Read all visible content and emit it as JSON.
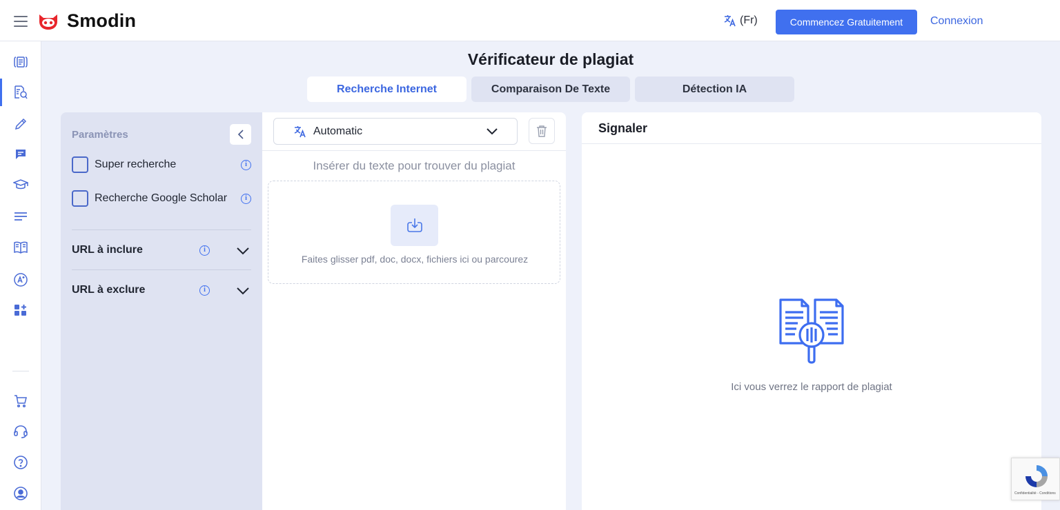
{
  "header": {
    "brand": "Smodin",
    "language_label": "(Fr)",
    "cta_label": "Commencez Gratuitement",
    "login_label": "Connexion"
  },
  "sidebar": {
    "items": [
      {
        "icon": "document-brackets-icon"
      },
      {
        "icon": "plagiarism-search-icon",
        "active": true
      },
      {
        "icon": "pencil-icon"
      },
      {
        "icon": "chat-icon"
      },
      {
        "icon": "graduation-cap-icon"
      },
      {
        "icon": "text-lines-icon"
      },
      {
        "icon": "book-icon"
      },
      {
        "icon": "ai-badge-icon"
      },
      {
        "icon": "apps-add-icon"
      },
      {
        "icon": "cart-icon"
      },
      {
        "icon": "headset-icon"
      },
      {
        "icon": "help-icon"
      },
      {
        "icon": "user-icon"
      }
    ]
  },
  "page": {
    "title": "Vérificateur de plagiat",
    "tabs": [
      {
        "label": "Recherche Internet",
        "active": true
      },
      {
        "label": "Comparaison De Texte",
        "active": false
      },
      {
        "label": "Détection IA",
        "active": false
      }
    ]
  },
  "settings": {
    "title": "Paramètres",
    "options": [
      {
        "label": "Super recherche",
        "checked": false
      },
      {
        "label": "Recherche Google Scholar",
        "checked": false
      }
    ],
    "url_include": "URL à inclure",
    "url_exclude": "URL à exclure"
  },
  "editor": {
    "language_value": "Automatic",
    "placeholder": "Insérer du texte pour trouver du plagiat",
    "dropzone_text": "Faites glisser pdf, doc, docx, fichiers ici ou parcourez"
  },
  "report": {
    "title": "Signaler",
    "empty_text": "Ici vous verrez le rapport de plagiat"
  },
  "recaptcha": {
    "footer": "Confidentialité - Conditions"
  },
  "colors": {
    "accent": "#4070ef",
    "panel": "#dfe3f2",
    "background": "#eef1fa",
    "brand_red": "#e8262c"
  }
}
